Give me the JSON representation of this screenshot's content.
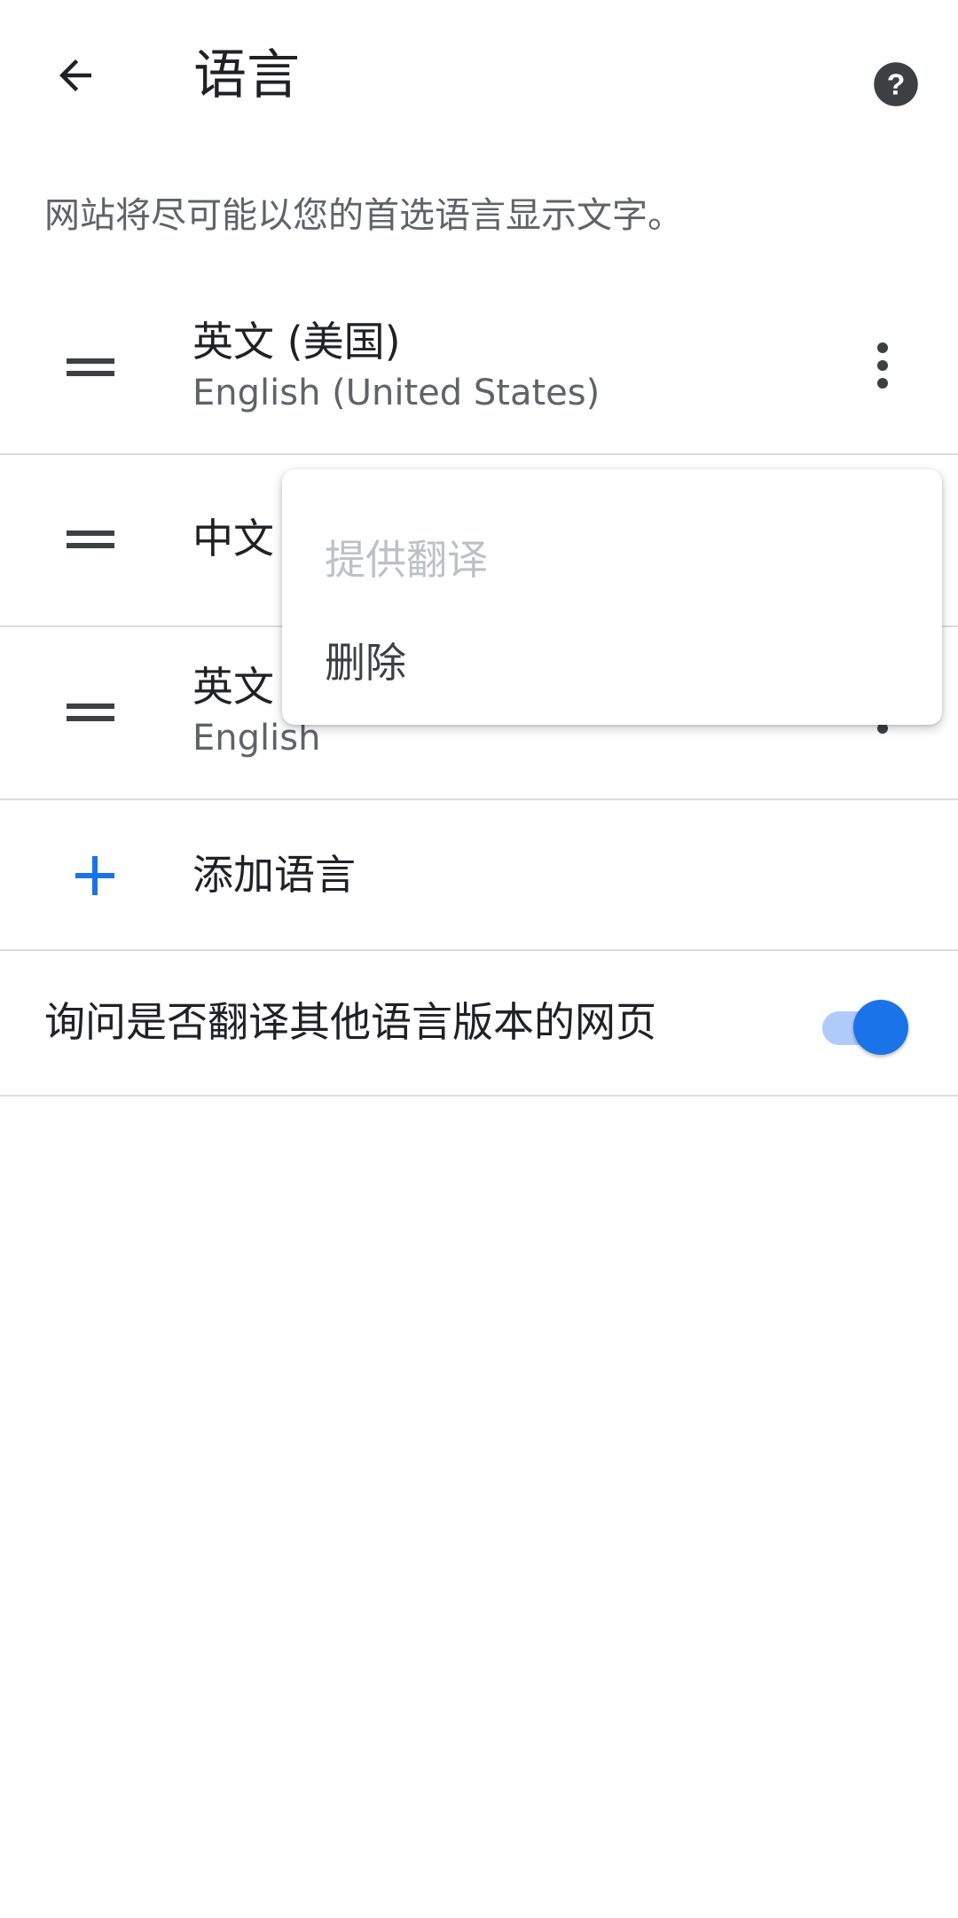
{
  "appbar": {
    "title": "语言",
    "back_icon": "arrow-back-icon",
    "help_icon": "help-circle-icon"
  },
  "description": "网站将尽可能以您的首选语言显示文字。",
  "languages": [
    {
      "name": "英文 (美国)",
      "subtitle": "English (United States)"
    },
    {
      "name": "中文",
      "subtitle": ""
    },
    {
      "name": "英文",
      "subtitle": "English"
    }
  ],
  "add_language": {
    "label": "添加语言",
    "icon": "plus-icon"
  },
  "translate_toggle": {
    "label": "询问是否翻译其他语言版本的网页",
    "enabled": true
  },
  "popup_menu": {
    "items": [
      {
        "label": "提供翻译",
        "enabled": false
      },
      {
        "label": "删除",
        "enabled": true
      }
    ]
  },
  "colors": {
    "accent": "#1a73e8",
    "accent_light": "#aecbfa",
    "divider": "#dadce0",
    "text_primary": "#202124",
    "text_secondary": "#5f6368",
    "text_disabled": "#bdc1c6"
  }
}
